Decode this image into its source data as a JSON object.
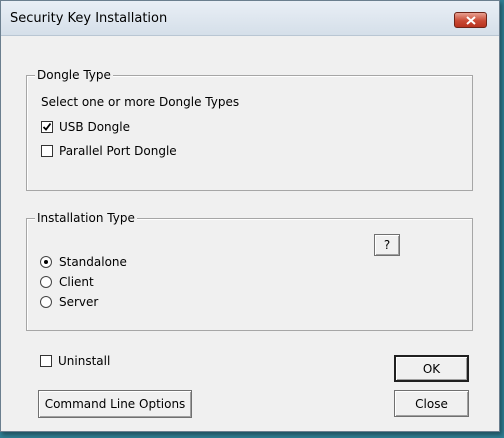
{
  "window": {
    "title": "Security Key Installation"
  },
  "dongle": {
    "group_label": "Dongle Type",
    "instruction": "Select one or more Dongle Types",
    "options": [
      {
        "label": "USB Dongle",
        "checked": true
      },
      {
        "label": "Parallel Port Dongle",
        "checked": false
      }
    ]
  },
  "installation": {
    "group_label": "Installation Type",
    "help_label": "?",
    "options": [
      {
        "label": "Standalone",
        "selected": true
      },
      {
        "label": "Client",
        "selected": false
      },
      {
        "label": "Server",
        "selected": false
      }
    ]
  },
  "uninstall": {
    "label": "Uninstall",
    "checked": false
  },
  "buttons": {
    "ok": "OK",
    "close": "Close",
    "command_line": "Command Line Options"
  }
}
